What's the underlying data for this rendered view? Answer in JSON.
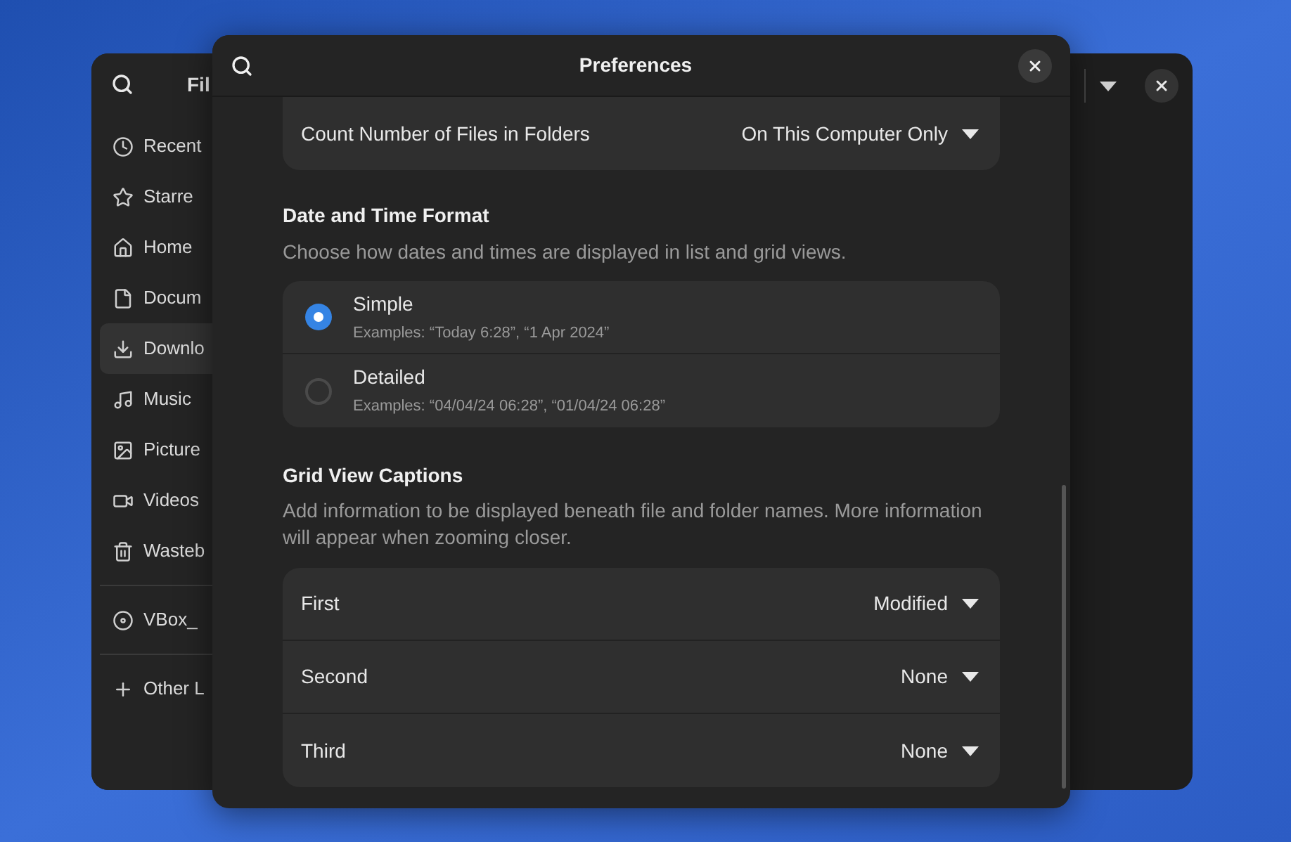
{
  "files_window": {
    "title": "Fil",
    "sidebar": {
      "items": [
        {
          "label": "Recent",
          "selected": false
        },
        {
          "label": "Starre",
          "selected": false
        },
        {
          "label": "Home",
          "selected": false
        },
        {
          "label": "Docum",
          "selected": false
        },
        {
          "label": "Downlo",
          "selected": true
        },
        {
          "label": "Music",
          "selected": false
        },
        {
          "label": "Picture",
          "selected": false
        },
        {
          "label": "Videos",
          "selected": false
        },
        {
          "label": "Wasteb",
          "selected": false
        },
        {
          "label": "VBox_",
          "selected": false
        },
        {
          "label": "Other L",
          "selected": false
        }
      ]
    }
  },
  "preferences": {
    "title": "Preferences",
    "count_row": {
      "label": "Count Number of Files in Folders",
      "value": "On This Computer Only"
    },
    "date_format": {
      "title": "Date and Time Format",
      "description": "Choose how dates and times are displayed in list and grid views.",
      "options": [
        {
          "label": "Simple",
          "example": "Examples: “Today 6:28”, “1 Apr 2024”",
          "selected": true
        },
        {
          "label": "Detailed",
          "example": "Examples: “04/04/24 06:28”, “01/04/24 06:28”",
          "selected": false
        }
      ]
    },
    "grid_captions": {
      "title": "Grid View Captions",
      "description": "Add information to be displayed beneath file and folder names. More information will appear when zooming closer.",
      "rows": [
        {
          "label": "First",
          "value": "Modified"
        },
        {
          "label": "Second",
          "value": "None"
        },
        {
          "label": "Third",
          "value": "None"
        }
      ]
    }
  }
}
